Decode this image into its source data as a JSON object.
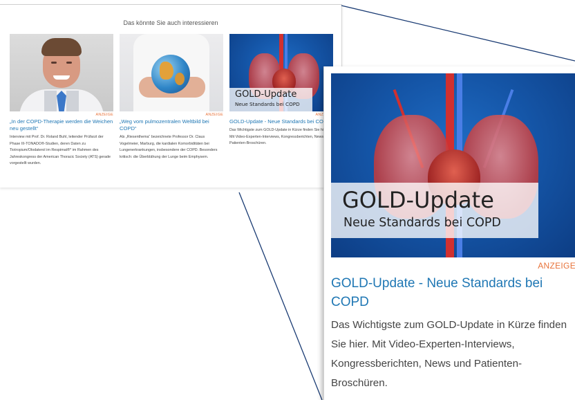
{
  "widget": {
    "title": "Das könnte Sie auch interessieren",
    "cards": [
      {
        "tag": "ANZEIGE",
        "headline": "„In der COPD-Therapie werden die Weichen neu gestellt“",
        "description": "Interview mit Prof. Dr. Roland Buhl, leitender Prüfarzt der Phase III-TONADO®-Studien, deren Daten zu Tiotropium/Olodaterol im Respimat®* im Rahmen des Jahreskongress der American Thoracic Society (ATS) gerade vorgestellt wurden."
      },
      {
        "tag": "ANZEIGE",
        "headline": "„Weg vom pulmozentralen Weltbild bei COPD“",
        "description": "Als „Riesenthema“ bezeichnete Professor Dr. Claus Vogelmeier, Marburg, die kardialen Komorbiditäten bei Lungenerkrankungen, insbesondere der COPD. Besonders kritisch: die Überblähung der Lunge beim Emphysem."
      },
      {
        "tag": "ANZEIGE",
        "headline": "GOLD-Update - Neue Standards bei COPD",
        "description": "Das Wichtigste zum GOLD-Update in Kürze finden Sie hier. Mit Video-Experten-Interviews, Kongressberichten, News und Patienten-Broschüren.",
        "image_title": "GOLD-Update",
        "image_subtitle": "Neue Standards bei COPD"
      }
    ]
  },
  "zoom": {
    "tag": "ANZEIGE",
    "headline": "GOLD-Update - Neue Standards bei COPD",
    "description": "Das Wichtigste zum GOLD-Update in Kürze finden Sie hier. Mit Video-Experten-Interviews, Kongressberichten, News und Patienten-Broschüren.",
    "image_title": "GOLD-Update",
    "image_subtitle": "Neue Standards bei COPD"
  },
  "colors": {
    "link": "#1f77b4",
    "tag": "#e8733a",
    "text": "#444444",
    "connector": "#1a3b73"
  }
}
